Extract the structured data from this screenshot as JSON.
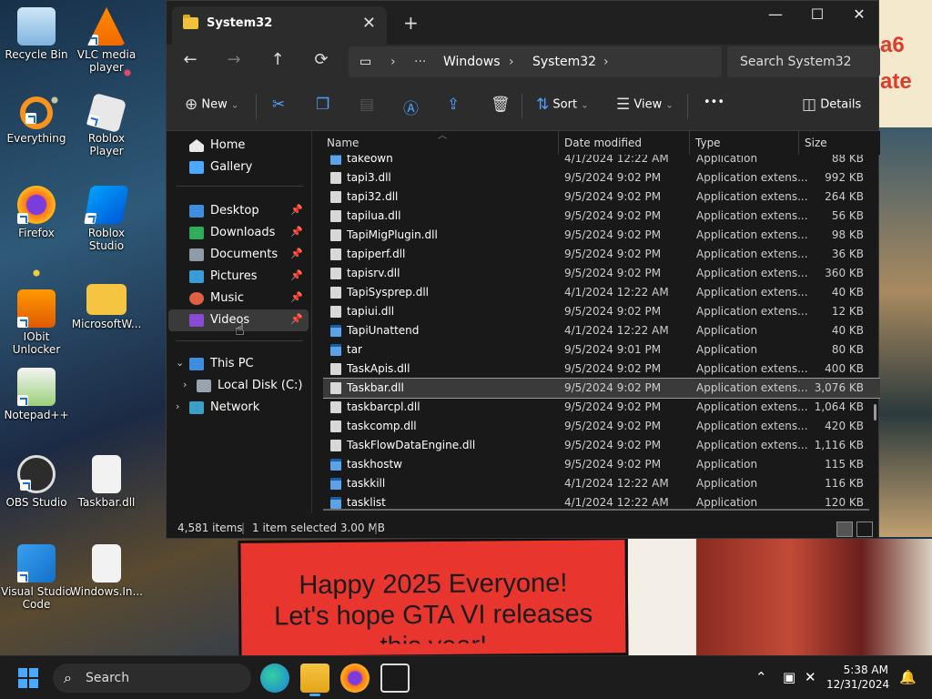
{
  "desktop": {
    "icons": [
      {
        "label": "Recycle Bin",
        "icon": "recycle-bin-icon"
      },
      {
        "label": "VLC media player",
        "icon": "vlc-icon"
      },
      {
        "label": "Everything",
        "icon": "everything-icon"
      },
      {
        "label": "Roblox Player",
        "icon": "roblox-icon"
      },
      {
        "label": "Firefox",
        "icon": "firefox-icon"
      },
      {
        "label": "Roblox Studio",
        "icon": "roblox-studio-icon"
      },
      {
        "label": "IObit Unlocker",
        "icon": "iobit-icon"
      },
      {
        "label": "MicrosoftW...",
        "icon": "folder-icon"
      },
      {
        "label": "Notepad++",
        "icon": "notepadpp-icon"
      },
      {
        "label": "OBS Studio",
        "icon": "obs-icon"
      },
      {
        "label": "Taskbar.dll",
        "icon": "dll-file-icon"
      },
      {
        "label": "Visual Studio Code",
        "icon": "vscode-icon"
      },
      {
        "label": "Windows.In...",
        "icon": "dll-file-icon"
      }
    ],
    "banner_line1": "Happy 2025 Everyone!",
    "banner_line2": "Let's hope GTA VI releases",
    "banner_line3": "this year!",
    "sign_line1": "a6",
    "sign_line2": "ate"
  },
  "window": {
    "tab_title": "System32",
    "new_tab": "+",
    "close_tab": "✕",
    "minimize": "—",
    "maximize": "☐",
    "close": "✕"
  },
  "navbar": {
    "back": "←",
    "forward": "→",
    "up": "↑",
    "refresh": "⟳",
    "breadcrumb": [
      "Windows",
      "System32"
    ],
    "search_placeholder": "Search System32"
  },
  "toolbar": {
    "new_label": "New",
    "sort_label": "Sort",
    "view_label": "View",
    "more_label": "•••",
    "details_label": "Details"
  },
  "sidebar": {
    "items": [
      {
        "label": "Home",
        "pinned": false
      },
      {
        "label": "Gallery",
        "pinned": false
      },
      {
        "label": "Desktop",
        "pinned": true
      },
      {
        "label": "Downloads",
        "pinned": true
      },
      {
        "label": "Documents",
        "pinned": true
      },
      {
        "label": "Pictures",
        "pinned": true
      },
      {
        "label": "Music",
        "pinned": true
      },
      {
        "label": "Videos",
        "pinned": true,
        "selected": true
      },
      {
        "label": "This PC",
        "pinned": false
      },
      {
        "label": "Local Disk (C:)",
        "pinned": false
      },
      {
        "label": "Network",
        "pinned": false
      }
    ]
  },
  "columns": {
    "name": "Name",
    "date": "Date modified",
    "type": "Type",
    "size": "Size"
  },
  "files": [
    {
      "name": "takeown",
      "date": "4/1/2024 12:22 AM",
      "type": "Application",
      "size": "88 KB",
      "app": true
    },
    {
      "name": "tapi3.dll",
      "date": "9/5/2024 9:02 PM",
      "type": "Application extens...",
      "size": "992 KB"
    },
    {
      "name": "tapi32.dll",
      "date": "9/5/2024 9:02 PM",
      "type": "Application extens...",
      "size": "264 KB"
    },
    {
      "name": "tapilua.dll",
      "date": "9/5/2024 9:02 PM",
      "type": "Application extens...",
      "size": "56 KB"
    },
    {
      "name": "TapiMigPlugin.dll",
      "date": "9/5/2024 9:02 PM",
      "type": "Application extens...",
      "size": "98 KB"
    },
    {
      "name": "tapiperf.dll",
      "date": "9/5/2024 9:02 PM",
      "type": "Application extens...",
      "size": "36 KB"
    },
    {
      "name": "tapisrv.dll",
      "date": "9/5/2024 9:02 PM",
      "type": "Application extens...",
      "size": "360 KB"
    },
    {
      "name": "TapiSysprep.dll",
      "date": "4/1/2024 12:22 AM",
      "type": "Application extens...",
      "size": "40 KB"
    },
    {
      "name": "tapiui.dll",
      "date": "9/5/2024 9:02 PM",
      "type": "Application extens...",
      "size": "12 KB"
    },
    {
      "name": "TapiUnattend",
      "date": "4/1/2024 12:22 AM",
      "type": "Application",
      "size": "40 KB",
      "app": true
    },
    {
      "name": "tar",
      "date": "9/5/2024 9:01 PM",
      "type": "Application",
      "size": "80 KB",
      "app": true
    },
    {
      "name": "TaskApis.dll",
      "date": "9/5/2024 9:02 PM",
      "type": "Application extens...",
      "size": "400 KB"
    },
    {
      "name": "Taskbar.dll",
      "date": "9/5/2024 9:02 PM",
      "type": "Application extens...",
      "size": "3,076 KB",
      "selected": true
    },
    {
      "name": "taskbarcpl.dll",
      "date": "9/5/2024 9:02 PM",
      "type": "Application extens...",
      "size": "1,064 KB"
    },
    {
      "name": "taskcomp.dll",
      "date": "9/5/2024 9:02 PM",
      "type": "Application extens...",
      "size": "420 KB"
    },
    {
      "name": "TaskFlowDataEngine.dll",
      "date": "9/5/2024 9:02 PM",
      "type": "Application extens...",
      "size": "1,116 KB"
    },
    {
      "name": "taskhostw",
      "date": "9/5/2024 9:02 PM",
      "type": "Application",
      "size": "115 KB",
      "app": true
    },
    {
      "name": "taskkill",
      "date": "4/1/2024 12:22 AM",
      "type": "Application",
      "size": "116 KB",
      "app": true
    },
    {
      "name": "tasklist",
      "date": "4/1/2024 12:22 AM",
      "type": "Application",
      "size": "120 KB",
      "app": true
    }
  ],
  "status": {
    "items": "4,581 items",
    "selected": "1 item selected  3.00 MB"
  },
  "taskbar": {
    "search_label": "Search",
    "time": "5:38 AM",
    "date": "12/31/2024"
  },
  "colors": {
    "accent": "#4aa8ff",
    "window_bg": "#191919",
    "toolbar_bg": "#2c2c2c"
  }
}
